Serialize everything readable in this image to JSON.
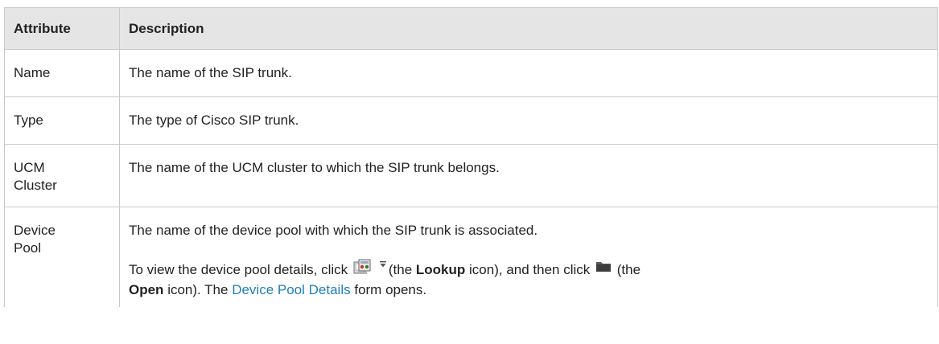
{
  "table": {
    "headers": {
      "attribute": "Attribute",
      "description": "Description"
    },
    "rows": {
      "name": {
        "attribute": "Name",
        "description": "The name of the SIP trunk."
      },
      "type": {
        "attribute": "Type",
        "description": "The type of Cisco SIP trunk."
      },
      "ucm": {
        "attribute_line1": "UCM",
        "attribute_line2": "Cluster",
        "description": "The name of the UCM cluster to which the SIP trunk belongs."
      },
      "device_pool": {
        "attribute_line1": "Device",
        "attribute_line2": "Pool",
        "description": "The name of the device pool with which the SIP trunk is associated.",
        "instr_part1": "To view the device pool details, click",
        "instr_part2": "(the",
        "instr_lookup": "Lookup",
        "instr_part3": "icon), and then click",
        "instr_part4": "(the",
        "instr_open": "Open",
        "instr_part5": "icon). The",
        "instr_link": "Device Pool Details",
        "instr_part6": "form opens."
      }
    }
  },
  "icons": {
    "lookup": "lookup-icon",
    "dropdown": "chevron-down-icon",
    "open": "folder-icon"
  },
  "colors": {
    "header_bg": "#e5e5e5",
    "border": "#c9c9c9",
    "link": "#1f7fb8",
    "text": "#222222"
  }
}
